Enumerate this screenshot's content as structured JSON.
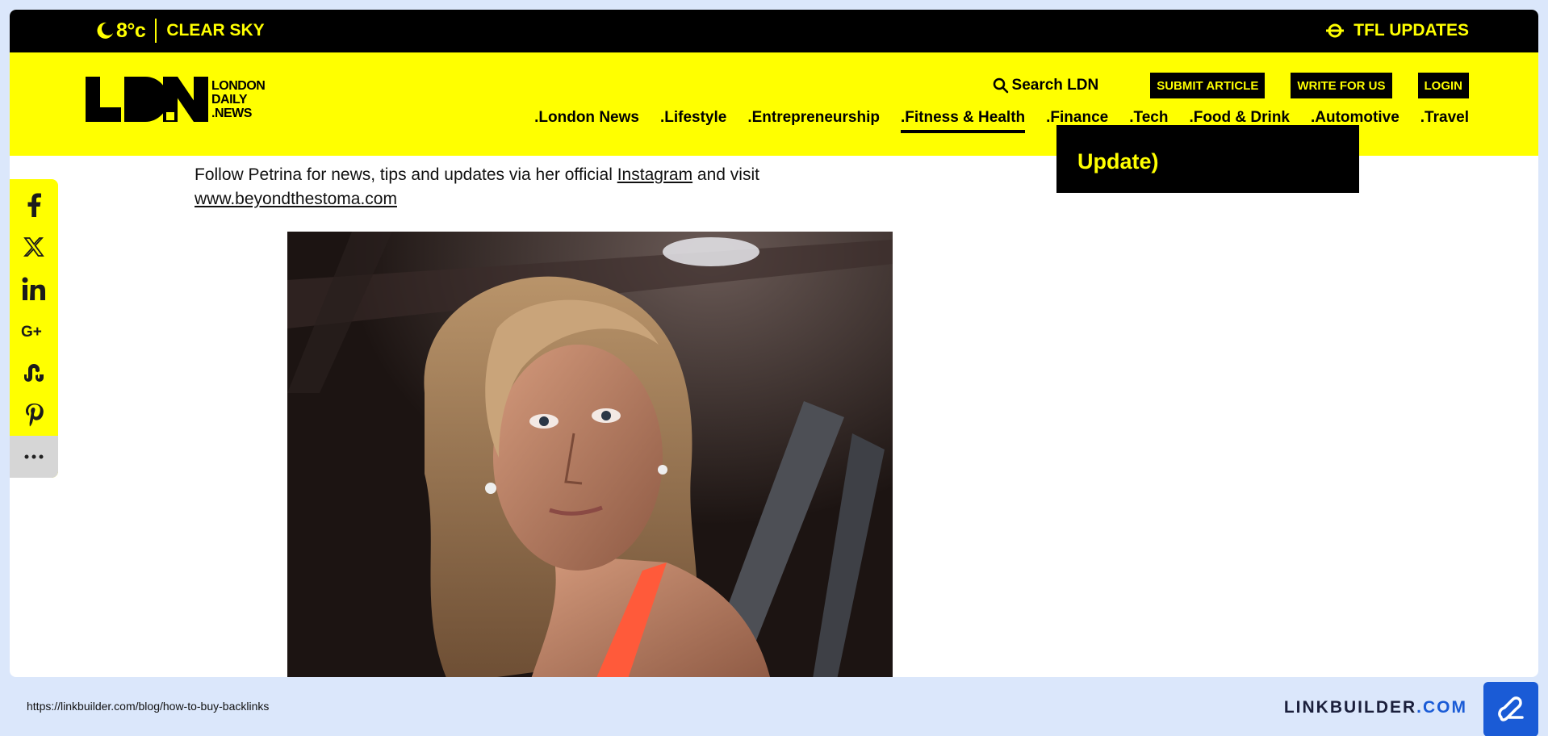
{
  "topbar": {
    "temperature": "8°c",
    "condition": "CLEAR SKY",
    "tfl_label": "TFL UPDATES"
  },
  "logo": {
    "line1": "LONDON",
    "line2": "DAILY",
    "line3": ".NEWS",
    "mark": "LDN"
  },
  "utility": {
    "search_label": "Search LDN",
    "submit_label": "SUBMIT ARTICLE",
    "write_label": "WRITE FOR US",
    "login_label": "LOGIN"
  },
  "nav": {
    "items": [
      {
        "label": ".London News"
      },
      {
        "label": ".Lifestyle"
      },
      {
        "label": ".Entrepreneurship"
      },
      {
        "label": ".Fitness & Health"
      },
      {
        "label": ".Finance"
      },
      {
        "label": ".Tech"
      },
      {
        "label": ".Food & Drink"
      },
      {
        "label": ".Automotive"
      },
      {
        "label": ".Travel"
      }
    ],
    "active": ".Fitness & Health"
  },
  "article": {
    "text_before": "Follow Petrina for news, tips and updates via her official ",
    "instagram_link": "Instagram",
    "text_middle": " and visit ",
    "site_link": "www.beyondthestoma.com"
  },
  "sidebar": {
    "box_text": "Update)"
  },
  "share": {
    "icons": [
      "facebook-icon",
      "x-icon",
      "linkedin-icon",
      "google-plus-icon",
      "stumbleupon-icon",
      "pinterest-icon",
      "more-icon"
    ]
  },
  "footer": {
    "url": "https://linkbuilder.com/blog/how-to-buy-backlinks",
    "brand_main": "LINKBUILDER",
    "brand_dot": ".",
    "brand_com": "COM"
  },
  "colors": {
    "accent_yellow": "#ffff00",
    "black": "#000000",
    "footer_bg": "#dbe7fb",
    "brand_blue": "#1a5bd6"
  }
}
